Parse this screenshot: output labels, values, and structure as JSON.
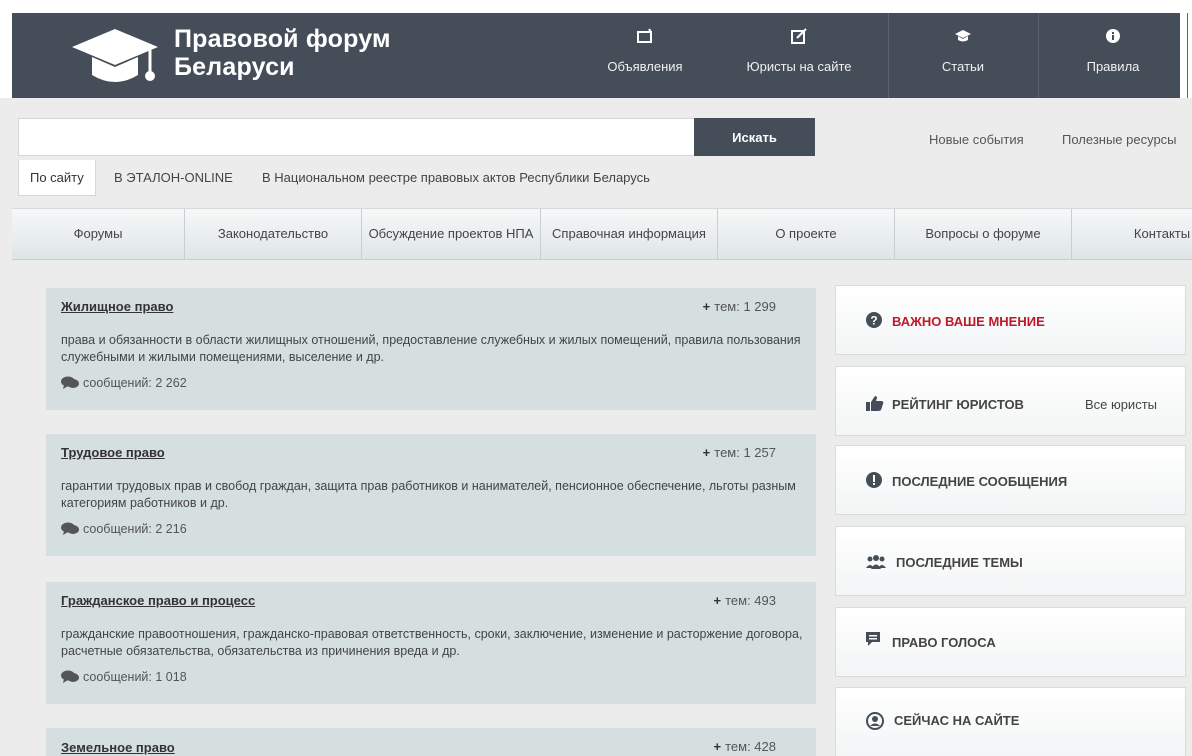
{
  "header": {
    "site_title_line1": "Правовой форум",
    "site_title_line2": "Беларуси",
    "nav": [
      {
        "label": "Объявления",
        "icon": "tv-icon"
      },
      {
        "label": "Юристы на сайте",
        "icon": "edit-icon"
      },
      {
        "label": "Статьи",
        "icon": "graduation-cap-icon"
      },
      {
        "label": "Правила",
        "icon": "info-icon"
      }
    ]
  },
  "search": {
    "value": "",
    "button_label": "Искать",
    "scopes": [
      "По сайту",
      "В ЭТАЛОН-ONLINE",
      "В Национальном реестре правовых актов Республики Беларусь"
    ],
    "active_scope": "По сайту"
  },
  "top_links": [
    "Новые события",
    "Полезные ресурсы"
  ],
  "main_nav": [
    "Форумы",
    "Законодательство",
    "Обсуждение проектов НПА",
    "Справочная информация",
    "О проекте",
    "Вопросы о форуме",
    "Контакты"
  ],
  "forums": [
    {
      "title": "Жилищное право",
      "topics": "тем: 1 299",
      "description": "права и обязанности в области жилищных отношений, предоставление служебных и жилых помещений, правила пользования служебными и жилыми помещениями, выселение и др.",
      "messages": "сообщений: 2 262"
    },
    {
      "title": "Трудовое право",
      "topics": "тем: 1 257",
      "description": "гарантии трудовых прав и свобод граждан, защита прав работников и нанимателей, пенсионное обеспечение, льготы разным категориям работников и др.",
      "messages": "сообщений: 2 216"
    },
    {
      "title": "Гражданское право и процесс",
      "topics": "тем: 493",
      "description": "гражданские правоотношения, гражданско-правовая ответственность, сроки, заключение, изменение и расторжение договора, расчетные обязательства, обязательства из причинения вреда и др.",
      "messages": "сообщений: 1 018"
    },
    {
      "title": "Земельное право",
      "topics": "тем: 428",
      "description": "",
      "messages": ""
    }
  ],
  "sidebar": [
    {
      "label": "ВАЖНО ВАШЕ МНЕНИЕ",
      "icon": "question-icon",
      "accent": "#c0172b"
    },
    {
      "label": "РЕЙТИНГ ЮРИСТОВ",
      "icon": "thumbs-up-icon",
      "extra": "Все юристы"
    },
    {
      "label": "ПОСЛЕДНИЕ СООБЩЕНИЯ",
      "icon": "exclamation-icon"
    },
    {
      "label": "ПОСЛЕДНИЕ ТЕМЫ",
      "icon": "users-icon"
    },
    {
      "label": "ПРАВО ГОЛОСА",
      "icon": "comment-icon"
    },
    {
      "label": "СЕЙЧАС НА САЙТЕ",
      "icon": "user-circle-icon"
    }
  ],
  "colors": {
    "header_bg": "#454d59",
    "forum_bg": "#d5dfe0",
    "accent_red": "#c0172b"
  }
}
